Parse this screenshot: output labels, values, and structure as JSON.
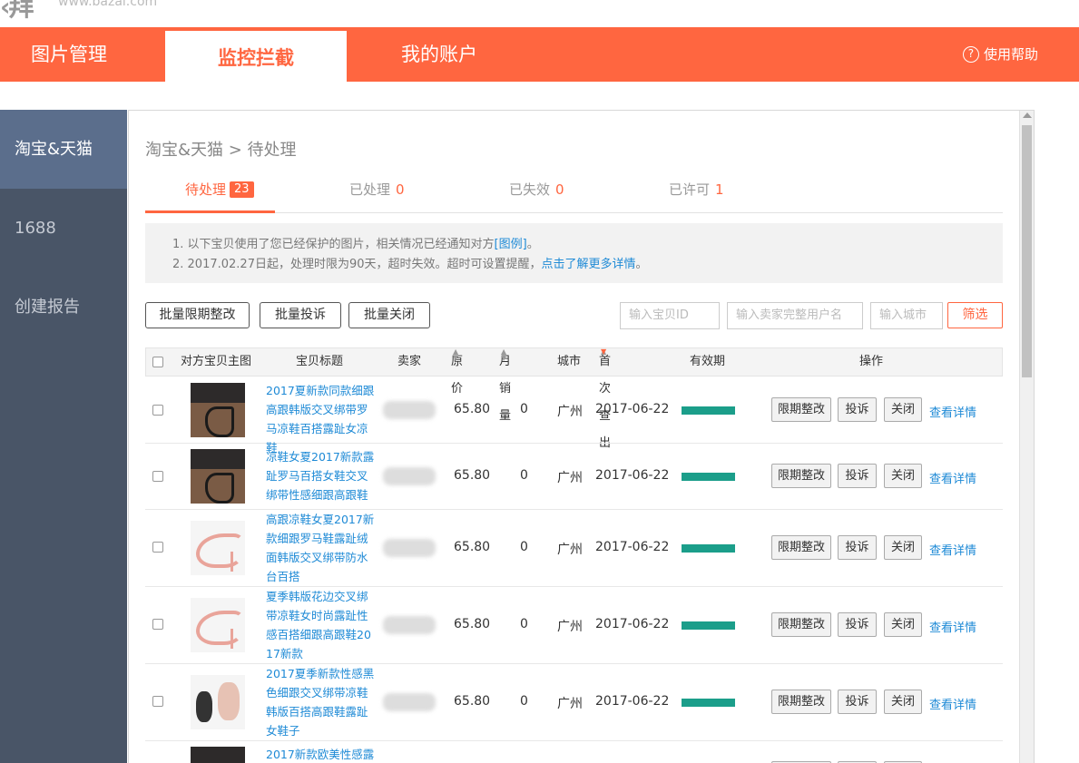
{
  "logo": {
    "url_text": "www.bazai.com"
  },
  "topnav": {
    "tabs": [
      "图片管理",
      "监控拦截",
      "我的账户"
    ],
    "help_label": "使用帮助"
  },
  "sidebar": {
    "items": [
      "淘宝&天猫",
      "1688",
      "创建报告"
    ]
  },
  "breadcrumb": "淘宝&天猫 > 待处理",
  "status_tabs": [
    {
      "label": "待处理",
      "count": "23"
    },
    {
      "label": "已处理",
      "count": "0"
    },
    {
      "label": "已失效",
      "count": "0"
    },
    {
      "label": "已许可",
      "count": "1"
    }
  ],
  "notice": {
    "line1_text": "1. 以下宝贝使用了您已经保护的图片，相关情况已经通知对方",
    "line1_link": "[图例]",
    "line1_end": "。",
    "line2_text": "2. 2017.02.27日起，处理时限为90天，超时失效。超时可设置提醒，",
    "line2_link": "点击了解更多详情",
    "line2_end": "。"
  },
  "toolbar": {
    "batch_fix": "批量限期整改",
    "batch_complain": "批量投诉",
    "batch_close": "批量关闭",
    "id_placeholder": "输入宝贝ID",
    "seller_placeholder": "输入卖家完整用户名",
    "city_placeholder": "输入城市",
    "filter_label": "筛选"
  },
  "table": {
    "headers": {
      "image": "对方宝贝主图",
      "title": "宝贝标题",
      "seller": "卖家",
      "price": "原价",
      "sales": "月销量",
      "city": "城市",
      "first_found": "首次查出",
      "validity": "有效期",
      "actions": "操作"
    },
    "action_labels": {
      "fix": "限期整改",
      "complain": "投诉",
      "close": "关闭",
      "detail": "查看详情"
    },
    "rows": [
      {
        "title": "2017夏新款同款细跟高跟韩版交叉绑带罗马凉鞋百搭露趾女凉鞋",
        "price": "65.80",
        "sales": "0",
        "city": "广州",
        "date": "2017-06-22",
        "image": "black-sandal-photo",
        "validity": 1.0
      },
      {
        "title": "凉鞋女夏2017新款露趾罗马百搭女鞋交叉绑带性感细跟高跟鞋",
        "price": "65.80",
        "sales": "0",
        "city": "广州",
        "date": "2017-06-22",
        "image": "black-sandal-photo",
        "validity": 1.0
      },
      {
        "title": "高跟凉鞋女夏2017新款细跟罗马鞋露趾绒面韩版交叉绑带防水台百搭",
        "price": "65.80",
        "sales": "0",
        "city": "广州",
        "date": "2017-06-22",
        "image": "pink-sandal-photo",
        "validity": 1.0
      },
      {
        "title": "夏季韩版花边交叉绑带凉鞋女时尚露趾性感百搭细跟高跟鞋2017新款",
        "price": "65.80",
        "sales": "0",
        "city": "广州",
        "date": "2017-06-22",
        "image": "pink-sandal-photo",
        "validity": 1.0
      },
      {
        "title": "2017夏季新款性感黑色细跟交叉绑带凉鞋韩版百搭高跟鞋露趾女鞋子",
        "price": "65.80",
        "sales": "0",
        "city": "广州",
        "date": "2017-06-22",
        "image": "multi-sandal-photo",
        "validity": 1.0
      },
      {
        "title": "2017新款欧美性感露",
        "image": "black-sandal-photo"
      }
    ]
  }
}
